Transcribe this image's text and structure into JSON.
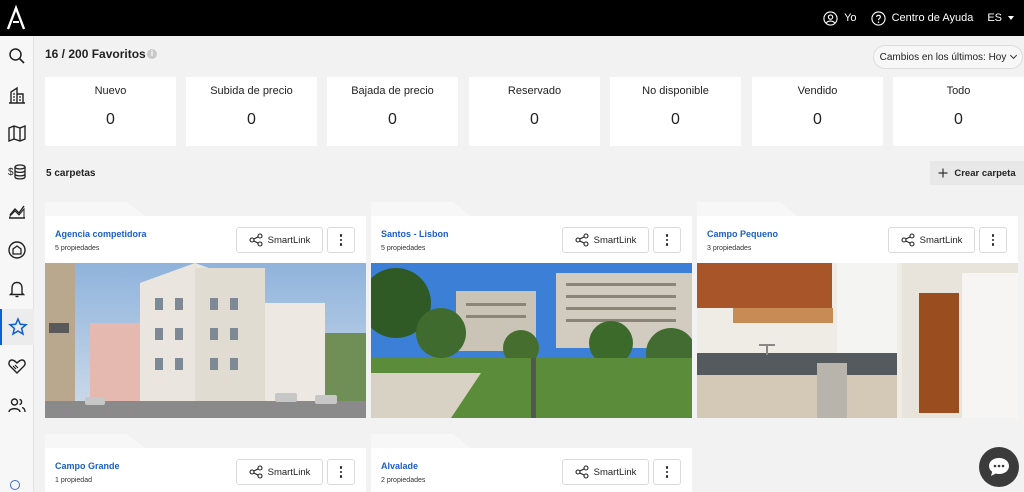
{
  "topbar": {
    "user_label": "Yo",
    "help_label": "Centro de Ayuda",
    "language": "ES"
  },
  "sidebar": {
    "items": [
      {
        "icon": "search-icon"
      },
      {
        "icon": "buildings-icon"
      },
      {
        "icon": "map-icon"
      },
      {
        "icon": "money-icon"
      },
      {
        "icon": "chart-icon"
      },
      {
        "icon": "valuation-icon"
      },
      {
        "icon": "bell-icon"
      },
      {
        "icon": "star-icon",
        "active": true
      },
      {
        "icon": "handshake-icon"
      },
      {
        "icon": "users-icon"
      }
    ]
  },
  "header": {
    "title": "16 / 200 Favoritos",
    "info_icon": "i",
    "changes_filter": "Cambios en los últimos: Hoy"
  },
  "stats": [
    {
      "label": "Nuevo",
      "value": "0"
    },
    {
      "label": "Subida de precio",
      "value": "0"
    },
    {
      "label": "Bajada de precio",
      "value": "0"
    },
    {
      "label": "Reservado",
      "value": "0"
    },
    {
      "label": "No disponible",
      "value": "0"
    },
    {
      "label": "Vendido",
      "value": "0"
    },
    {
      "label": "Todo",
      "value": "0"
    }
  ],
  "folders_header": {
    "count_label": "5 carpetas",
    "create_label": "Crear carpeta"
  },
  "folders": [
    {
      "name": "Agencia competidora",
      "count": "5 propiedades",
      "smartlink": "SmartLink"
    },
    {
      "name": "Santos - Lisbon",
      "count": "5 propiedades",
      "smartlink": "SmartLink"
    },
    {
      "name": "Campo Pequeno",
      "count": "3 propiedades",
      "smartlink": "SmartLink"
    },
    {
      "name": "Campo Grande",
      "count": "1 propiedad",
      "smartlink": "SmartLink"
    },
    {
      "name": "Alvalade",
      "count": "2 propiedades",
      "smartlink": "SmartLink"
    }
  ],
  "colors": {
    "accent": "#1b5fc4",
    "topbar": "#000000"
  }
}
